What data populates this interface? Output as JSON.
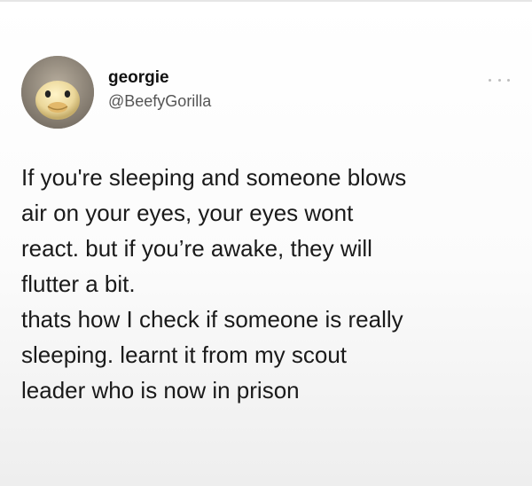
{
  "tweet": {
    "author": {
      "display_name": "georgie",
      "handle": "@BeefyGorilla",
      "avatar_icon": "duck-avatar-icon"
    },
    "more_icon": "more-dots-icon",
    "text_lines": [
      "If you're sleeping and someone blows",
      "air on your eyes, your eyes wont",
      "react. but if you’re awake, they will",
      "flutter a bit.",
      "thats how I check if someone is really",
      "sleeping. learnt it from my scout",
      "leader who is now in prison"
    ]
  },
  "colors": {
    "text": "#1a1a1a",
    "handle": "#555555",
    "background": "#ffffff"
  }
}
